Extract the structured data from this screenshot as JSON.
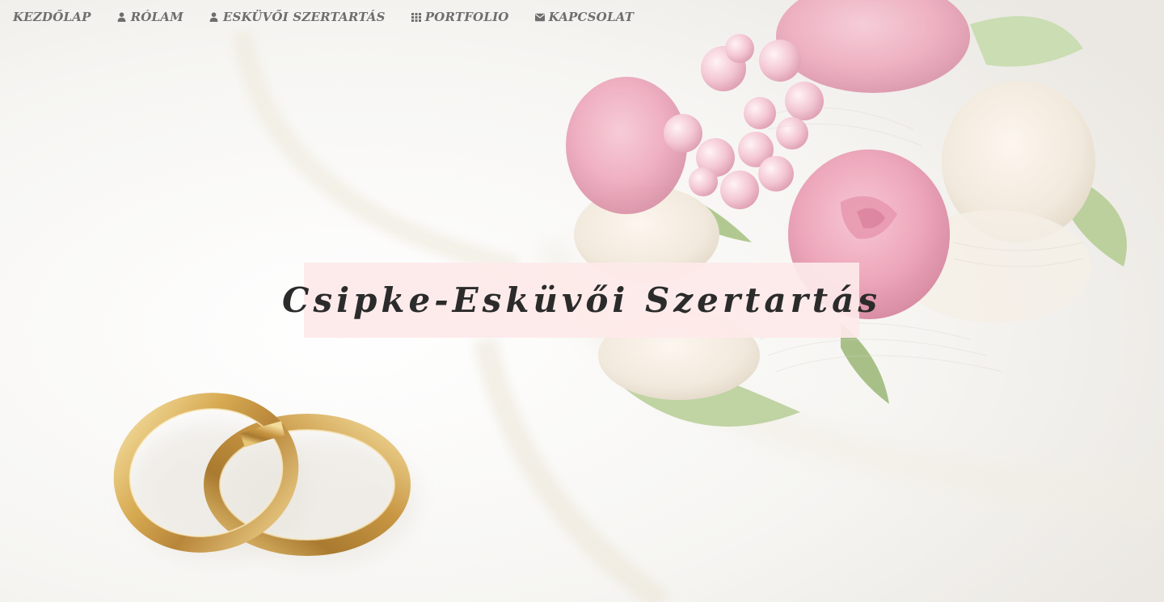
{
  "nav": {
    "items": [
      {
        "label": "KEZDŐLAP",
        "icon": "none"
      },
      {
        "label": "RÓLAM",
        "icon": "user-icon"
      },
      {
        "label": "ESKÜVŐI SZERTARTÁS",
        "icon": "user-icon"
      },
      {
        "label": "PORTFOLIO",
        "icon": "grid-icon"
      },
      {
        "label": "KAPCSOLAT",
        "icon": "envelope-icon"
      }
    ],
    "color": "#6e6e6e"
  },
  "hero": {
    "title": "Csipke-Esküvői Szertartás",
    "banner_color": "#fde9ea",
    "image_subject": "wedding-rings-and-roses"
  }
}
